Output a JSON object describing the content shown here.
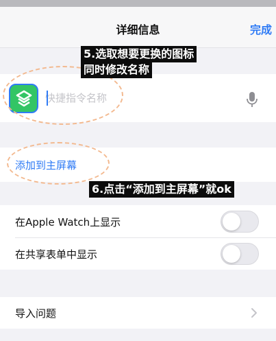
{
  "nav": {
    "title": "详细信息",
    "done_label": "完成"
  },
  "annotations": {
    "step5_line1": "5.选取想要更换的图标",
    "step5_line2": "同时修改名称",
    "step6": "6.点击“添加到主屏幕”就ok"
  },
  "shortcut": {
    "name_placeholder": "快捷指令名称",
    "name_value": ""
  },
  "add_to_home": {
    "label": "添加到主屏幕"
  },
  "toggles": [
    {
      "label": "在Apple Watch上显示",
      "on": false
    },
    {
      "label": "在共享表单中显示",
      "on": false
    }
  ],
  "import": {
    "label": "导入问题"
  },
  "colors": {
    "accent": "#2f7bf5",
    "icon_green": "#33c565",
    "annotation_bg": "#0c0c0c",
    "dash_orange": "#f3b98f"
  }
}
